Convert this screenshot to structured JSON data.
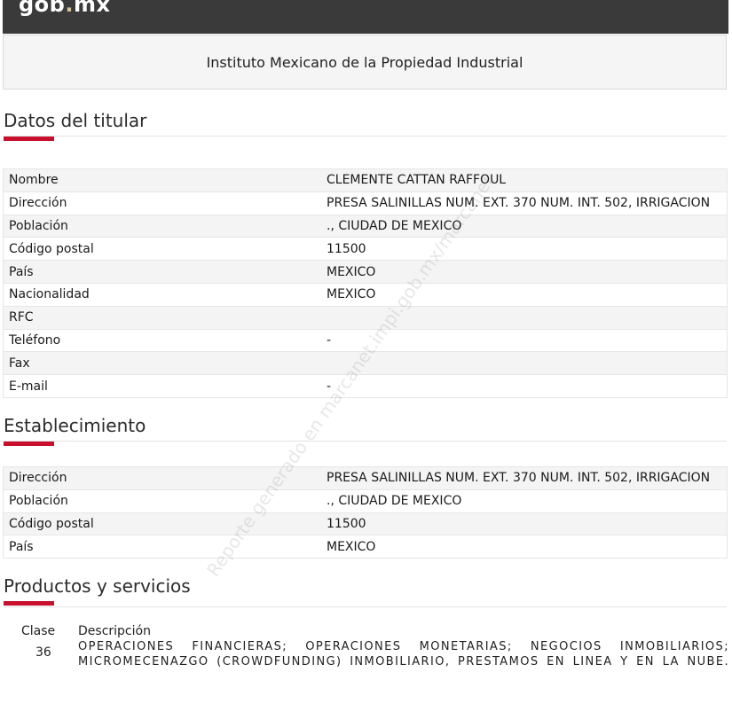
{
  "header": {
    "logo_text_a": "gob",
    "logo_dot": ".",
    "logo_text_b": "mx",
    "institute": "Instituto Mexicano de la Propiedad Industrial"
  },
  "titular": {
    "title": "Datos del titular",
    "rows": [
      {
        "label": "Nombre",
        "value": "CLEMENTE CATTAN  RAFFOUL"
      },
      {
        "label": "Dirección",
        "value": "PRESA SALINILLAS NUM. EXT. 370 NUM. INT. 502, IRRIGACION"
      },
      {
        "label": "Población",
        "value": "., CIUDAD DE MEXICO"
      },
      {
        "label": "Código postal",
        "value": "11500"
      },
      {
        "label": "País",
        "value": "MEXICO"
      },
      {
        "label": "Nacionalidad",
        "value": "MEXICO"
      },
      {
        "label": "RFC",
        "value": ""
      },
      {
        "label": "Teléfono",
        "value": "-"
      },
      {
        "label": "Fax",
        "value": ""
      },
      {
        "label": "E-mail",
        "value": "-"
      }
    ]
  },
  "establecimiento": {
    "title": "Establecimiento",
    "rows": [
      {
        "label": "Dirección",
        "value": "PRESA SALINILLAS NUM. EXT. 370 NUM. INT. 502, IRRIGACION"
      },
      {
        "label": "Población",
        "value": "., CIUDAD DE MEXICO"
      },
      {
        "label": "Código postal",
        "value": "11500"
      },
      {
        "label": "País",
        "value": "MEXICO"
      }
    ]
  },
  "productos": {
    "title": "Productos y servicios",
    "col_clase": "Clase",
    "col_descripcion": "Descripción",
    "items": [
      {
        "clase": "36",
        "descripcion": "OPERACIONES FINANCIERAS; OPERACIONES MONETARIAS; NEGOCIOS INMOBILIARIOS; MICROMECENAZGO (CROWDFUNDING) INMOBILIARIO, PRESTAMOS EN LINEA Y EN LA NUBE."
      }
    ]
  },
  "watermark": "Reporte generado en marcanet.impi.gob.mx/marcanet",
  "colors": {
    "accent": "#c8102e",
    "topbar": "#3a3a3a"
  }
}
